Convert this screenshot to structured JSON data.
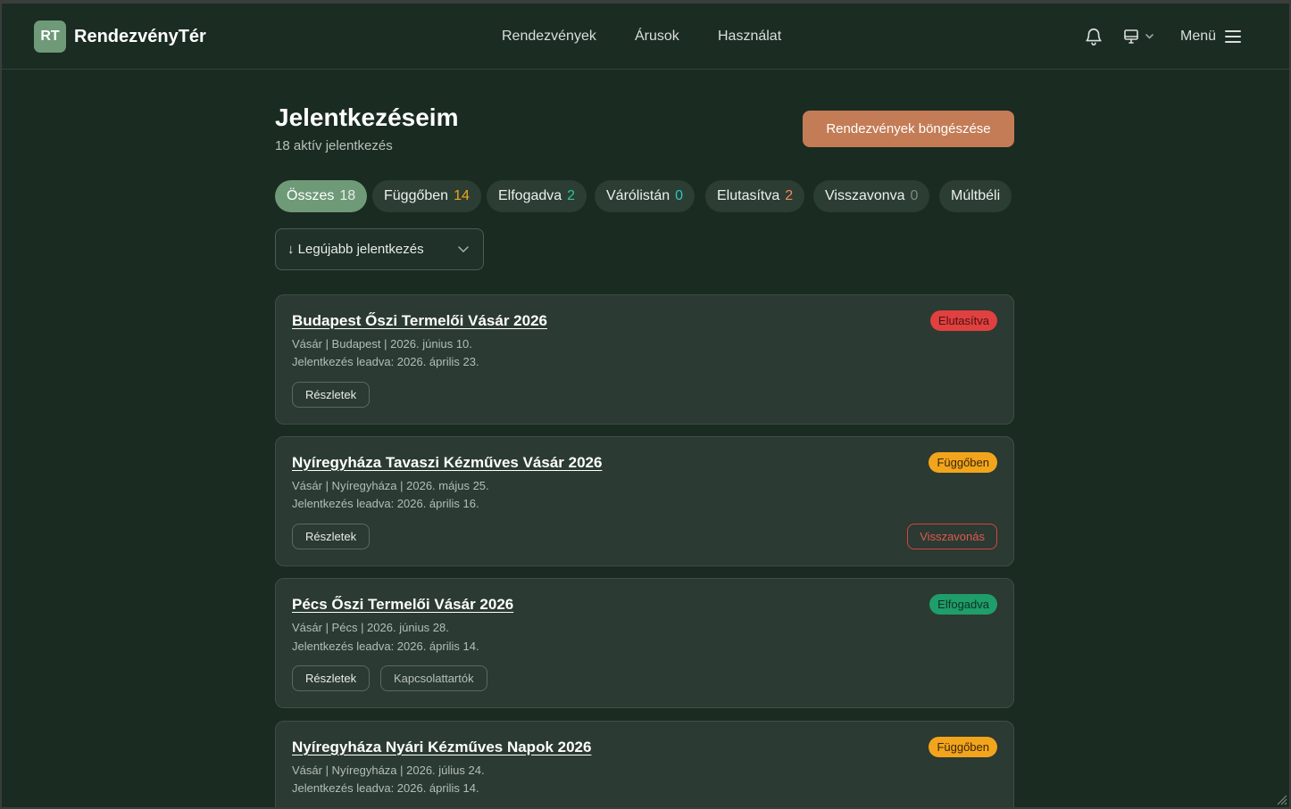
{
  "header": {
    "logo_initials": "RT",
    "brand": "RendezvényTér",
    "nav": [
      "Rendezvények",
      "Árusok",
      "Használat"
    ],
    "menu_label": "Menü"
  },
  "main": {
    "title": "Jelentkezéseim",
    "subtitle": "18 aktív jelentkezés",
    "browse_button": "Rendezvények böngészése",
    "tabs": [
      {
        "label": "Összes",
        "count": "18"
      },
      {
        "label": "Függőben",
        "count": "14"
      },
      {
        "label": "Elfogadva",
        "count": "2"
      },
      {
        "label": "Várólistán",
        "count": "0"
      },
      {
        "label": "Elutasítva",
        "count": "2"
      },
      {
        "label": "Visszavonva",
        "count": "0"
      },
      {
        "label": "Múltbéli",
        "count": ""
      }
    ],
    "sort_label": "↓ Legújabb jelentkezés",
    "cards": [
      {
        "title": "Budapest Őszi Termelői Vásár 2026",
        "meta": "Vásár | Budapest | 2026. június 10.",
        "submitted": "Jelentkezés leadva: 2026. április 23.",
        "status": "Elutasítva",
        "details": "Részletek"
      },
      {
        "title": "Nyíregyháza Tavaszi Kézműves Vásár 2026",
        "meta": "Vásár | Nyíregyháza | 2026. május 25.",
        "submitted": "Jelentkezés leadva: 2026. április 16.",
        "status": "Függőben",
        "details": "Részletek",
        "withdraw": "Visszavonás"
      },
      {
        "title": "Pécs Őszi Termelői Vásár 2026",
        "meta": "Vásár | Pécs | 2026. június 28.",
        "submitted": "Jelentkezés leadva: 2026. április 14.",
        "status": "Elfogadva",
        "details": "Részletek",
        "contacts": "Kapcsolattartók"
      },
      {
        "title": "Nyíregyháza Nyári Kézműves Napok 2026",
        "meta": "Vásár | Nyíregyháza | 2026. július 24.",
        "submitted": "Jelentkezés leadva: 2026. április 14.",
        "status": "Függőben"
      }
    ]
  },
  "colors": {
    "background": "#1a2b22",
    "accent_green": "#6f9a78",
    "accent_orange": "#c47c56",
    "status_rejected": "#e0403f",
    "status_pending": "#f2a51c",
    "status_accepted": "#1f9d6a",
    "count_pending": "#f2a51c",
    "count_accepted": "#2ec49a",
    "count_waitlist": "#2ec4c4",
    "count_rejected": "#f08a5d",
    "count_withdrawn": "#7d8a83"
  },
  "icons": [
    "bell-icon",
    "monitor-icon",
    "chevron-down-icon",
    "hamburger-icon"
  ]
}
